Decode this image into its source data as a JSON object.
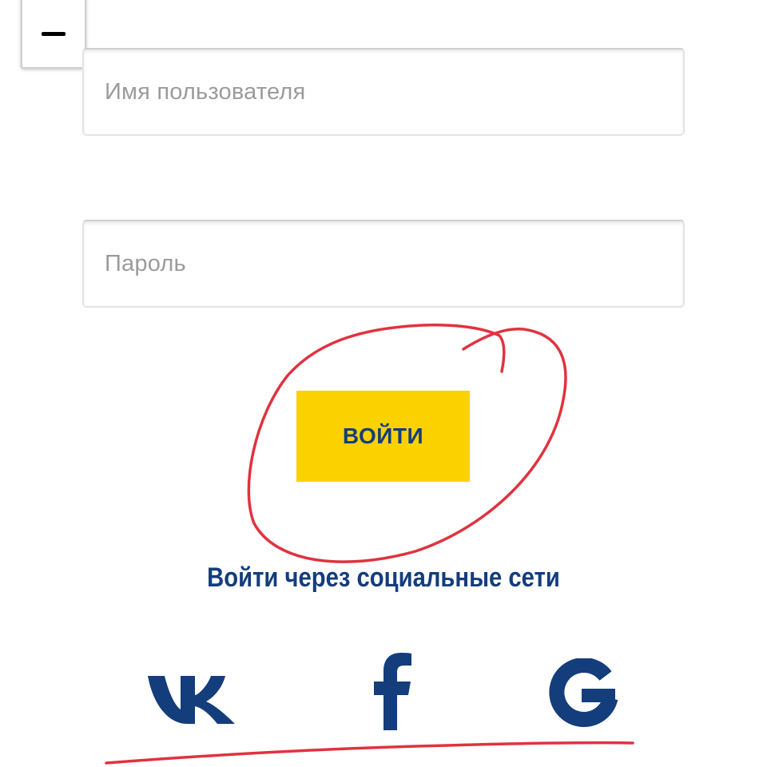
{
  "form": {
    "username_placeholder": "Имя пользователя",
    "password_placeholder": "Пароль",
    "login_label": "ВОЙТИ"
  },
  "social": {
    "title": "Войти через социальные сети",
    "items": [
      {
        "icon": "vk-icon"
      },
      {
        "icon": "facebook-icon"
      },
      {
        "icon": "google-icon"
      }
    ]
  },
  "colors": {
    "brand_blue": "#143d7c",
    "button_yellow": "#fbd200",
    "annotation_red": "#e0333f",
    "placeholder_gray": "#9b9b9b"
  }
}
